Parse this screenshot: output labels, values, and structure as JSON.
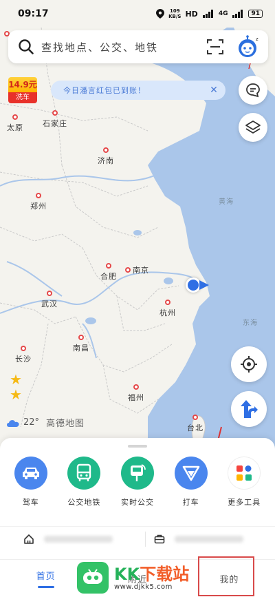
{
  "status": {
    "time": "09:17",
    "net_speed_top": "109",
    "net_speed_bottom": "KB/S",
    "hd": "HD",
    "signal": "4G",
    "battery": "91"
  },
  "search": {
    "placeholder": "查找地点、公交、地铁"
  },
  "promo": {
    "price": "14.9元",
    "label": "洗车"
  },
  "notice": {
    "text": "今日潘言红包已到账！"
  },
  "map": {
    "cities": {
      "taiyuan": "太原",
      "shijiazhuang": "石家庄",
      "jinan": "济南",
      "zhengzhou": "郑州",
      "hefei": "合肥",
      "nanjing": "南京",
      "wuhan": "武汉",
      "hangzhou": "杭州",
      "nanchang": "南昌",
      "changsha": "长沙",
      "fuzhou": "福州",
      "taibei": "台北"
    },
    "seas": {
      "yellow_sea": "黄海",
      "east_sea": "东海"
    },
    "weather_temp": "22°",
    "brand": "高德地图"
  },
  "services": [
    {
      "label": "驾车",
      "icon": "car-icon",
      "color": "#4a86ee"
    },
    {
      "label": "公交地铁",
      "icon": "bus-icon",
      "color": "#1fb98a"
    },
    {
      "label": "实时公交",
      "icon": "realtime-bus-icon",
      "color": "#1fb98a"
    },
    {
      "label": "打车",
      "icon": "taxi-icon",
      "color": "#4a86ee"
    },
    {
      "label": "更多工具",
      "icon": "more-tools-icon",
      "color": "#ffffff"
    }
  ],
  "tabs": {
    "home": "首页",
    "nearby": "附近",
    "mine": "我的"
  },
  "watermark": {
    "title_a": "KK",
    "title_b": "下载站",
    "url": "www.djkk5.com"
  }
}
